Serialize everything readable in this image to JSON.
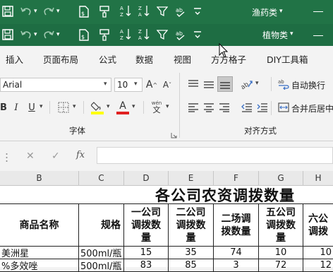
{
  "titlebar_back": {
    "title": "渔药类"
  },
  "titlebar_front": {
    "title": "植物类"
  },
  "ribbon_tabs": [
    "插入",
    "页面布局",
    "公式",
    "数据",
    "视图",
    "方方格子",
    "DIY工具箱"
  ],
  "font": {
    "name": "Arial",
    "size": "10",
    "increase": "A",
    "decrease": "A",
    "bold": "B",
    "italic": "I",
    "underline": "U",
    "group_label": "字体",
    "phonetic": "wén"
  },
  "alignment": {
    "wrap_text": "自动换行",
    "merge_center": "合并后居中",
    "group_label": "对齐方式"
  },
  "formula_bar": {
    "fx": "fx",
    "value": ""
  },
  "columns": [
    "B",
    "C",
    "D",
    "E",
    "F",
    "G",
    "H"
  ],
  "sheet": {
    "title": "各公司农资调拨数量",
    "headers": {
      "name": "商品名称",
      "spec": "规格",
      "d": "一公司调拨数量",
      "e": "二公司调拨数量",
      "f": "二场调拨数量",
      "g": "五公司调拨数量",
      "h": "六公调拨"
    },
    "rows": [
      {
        "name": "美洲星",
        "spec": "500ml/瓶",
        "d": "15",
        "e": "35",
        "f": "74",
        "g": "10",
        "h": "10"
      },
      {
        "name": "%多效唑",
        "spec": "500ml/瓶",
        "d": "83",
        "e": "85",
        "f": "3",
        "g": "72",
        "h": "12"
      }
    ]
  },
  "colors": {
    "excel_green": "#217346",
    "font_color_red": "#e02020",
    "highlight_yellow": "#ffff00"
  }
}
